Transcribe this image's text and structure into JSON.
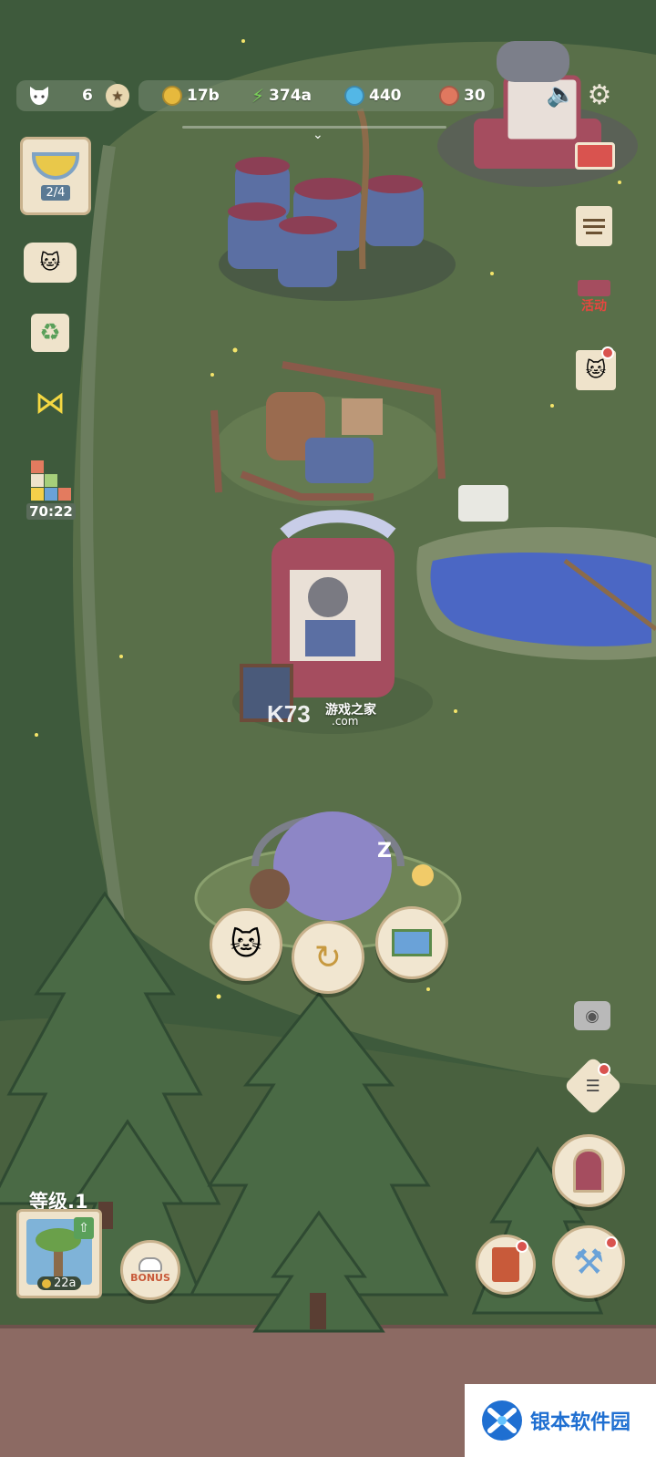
{
  "hud": {
    "cats": "6",
    "coins": "17b",
    "energy": "374a",
    "gems": "440",
    "tickets": "30"
  },
  "left": {
    "soup_progress": "2/4",
    "timer": "70:22"
  },
  "right": {
    "event_label": "活动"
  },
  "bottom": {
    "level_label": "等级.1",
    "upgrade_cost": "22a",
    "bonus_label": "BONUS"
  },
  "watermark": {
    "center_logo": "K73",
    "center_cn": "游戏之家",
    "center_url": ".com",
    "corner_label": "银本软件园"
  },
  "colors": {
    "grass": "#596f49",
    "forest": "#3e5a3c",
    "pond": "#4b67c4",
    "panel": "#f1e6d0",
    "brand": "#1f6fd1"
  }
}
